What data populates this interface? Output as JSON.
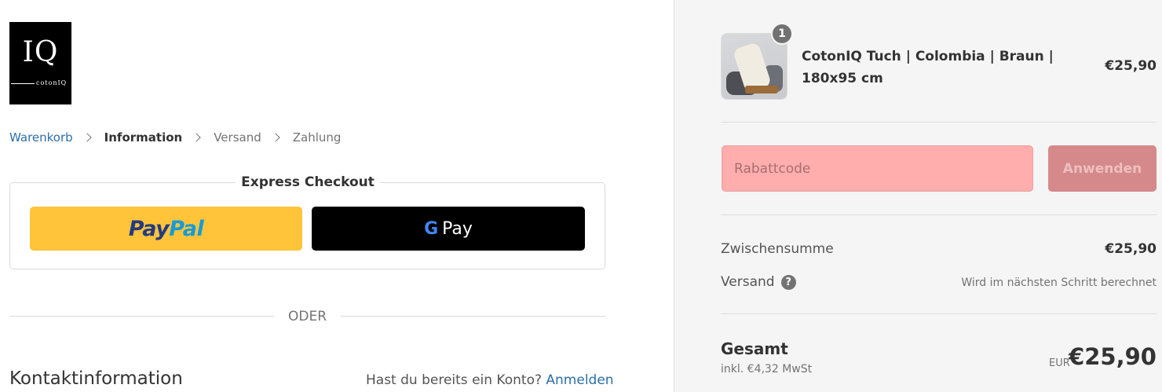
{
  "logo": {
    "mark": "IQ",
    "sub": "cotonIQ"
  },
  "breadcrumb": {
    "cart": "Warenkorb",
    "information": "Information",
    "shipping": "Versand",
    "payment": "Zahlung"
  },
  "express": {
    "title": "Express Checkout",
    "paypal_part1": "Pay",
    "paypal_part2": "Pal",
    "gpay_g": "G",
    "gpay_label": "Pay"
  },
  "divider_text": "ODER",
  "contact": {
    "title": "Kontaktinformation",
    "account_question": "Hast du bereits ein Konto?",
    "login_link": "Anmelden"
  },
  "cart": {
    "items": [
      {
        "quantity": "1",
        "name": "CotonIQ Tuch | Colombia | Braun | 180x95 cm",
        "price": "€25,90"
      }
    ]
  },
  "discount": {
    "placeholder": "Rabattcode",
    "apply_label": "Anwenden"
  },
  "summary": {
    "subtotal_label": "Zwischensumme",
    "subtotal_value": "€25,90",
    "shipping_label": "Versand",
    "shipping_help_icon": "?",
    "shipping_value": "Wird im nächsten Schritt berechnet",
    "total_label": "Gesamt",
    "tax_note": "inkl. €4,32 MwSt",
    "currency": "EUR",
    "total_value": "€25,90"
  },
  "colors": {
    "link": "#2d6ea8",
    "paypal_yellow": "#ffc439",
    "discount_field_error": "#ffadad",
    "apply_button": "#d6898b"
  }
}
